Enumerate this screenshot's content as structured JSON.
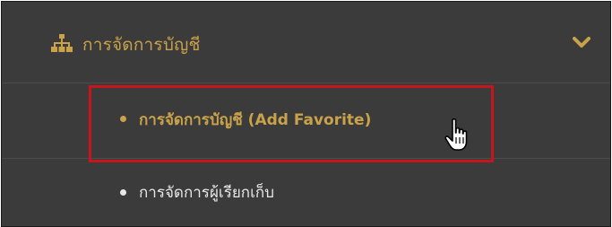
{
  "menu": {
    "header_label": "การจัดการบัญชี",
    "header_icon": "sitemap-icon",
    "expand_icon": "chevron-down-icon",
    "accent_color": "#c9a24a",
    "items": [
      {
        "label": "การจัดการบัญชี (Add Favorite)",
        "state": "hover"
      },
      {
        "label": "การจัดการผู้เรียกเก็บ",
        "state": "normal"
      }
    ]
  },
  "annotation": {
    "highlight_color": "#c8151b",
    "cursor_icon": "hand-pointer-icon"
  }
}
